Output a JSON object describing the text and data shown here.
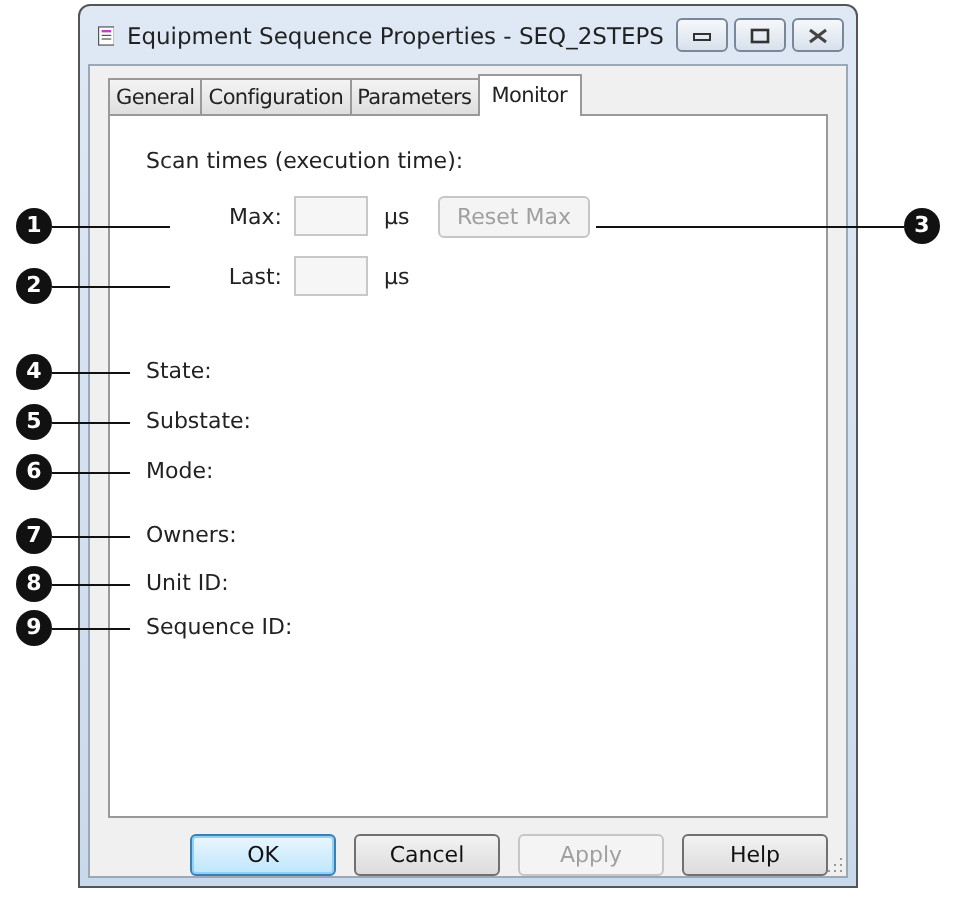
{
  "window": {
    "title": "Equipment Sequence Properties - SEQ_2STEPS"
  },
  "tabs": [
    {
      "label": "General",
      "selected": false
    },
    {
      "label": "Configuration",
      "selected": false
    },
    {
      "label": "Parameters",
      "selected": false
    },
    {
      "label": "Monitor",
      "selected": true
    }
  ],
  "scan_times": {
    "heading": "Scan times (execution time):",
    "rows": [
      {
        "label": "Max:",
        "unit": "µs"
      },
      {
        "label": "Last:",
        "unit": "µs"
      }
    ],
    "reset_button": {
      "label": "Reset Max",
      "disabled": true
    }
  },
  "status_fields": [
    {
      "label": "State:"
    },
    {
      "label": "Substate:"
    },
    {
      "label": "Mode:"
    },
    {
      "label": "Owners:"
    },
    {
      "label": "Unit ID:"
    },
    {
      "label": "Sequence ID:"
    }
  ],
  "callouts": [
    "1",
    "3",
    "2",
    "4",
    "5",
    "6",
    "7",
    "8",
    "9"
  ],
  "buttons": [
    {
      "label": "OK",
      "default": true,
      "disabled": false
    },
    {
      "label": "Cancel",
      "default": false,
      "disabled": false
    },
    {
      "label": "Apply",
      "default": false,
      "disabled": true
    },
    {
      "label": "Help",
      "default": false,
      "disabled": false
    }
  ]
}
